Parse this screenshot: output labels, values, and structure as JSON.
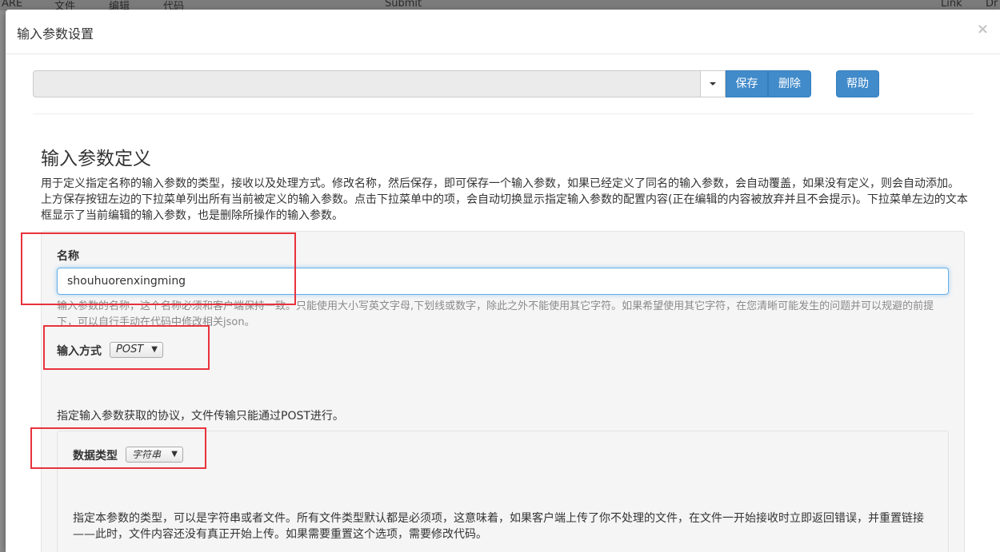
{
  "background": {
    "menu_items": [
      "ARE",
      "文件",
      "编辑",
      "代码",
      "Submit",
      "Link",
      "Dr"
    ]
  },
  "dialog": {
    "title": "输入参数设置",
    "close_label": "×"
  },
  "toolbar": {
    "select_value": "",
    "save_label": "保存",
    "delete_label": "删除",
    "help_label": "帮助"
  },
  "section": {
    "title": "输入参数定义",
    "intro": "用于定义指定名称的输入参数的类型，接收以及处理方式。修改名称，然后保存，即可保存一个输入参数，如果已经定义了同名的输入参数，会自动覆盖，如果没有定义，则会自动添加。上方保存按钮左边的下拉菜单列出所有当前被定义的输入参数。点击下拉菜单中的项，会自动切换显示指定输入参数的配置内容(正在编辑的内容被放弃并且不会提示)。下拉菜单左边的文本框显示了当前编辑的输入参数，也是删除所操作的输入参数。"
  },
  "form": {
    "name_label": "名称",
    "name_value": "shouhuorenxingming",
    "name_help": "输入参数的名称，这个名称必须和客户端保持一致。只能使用大小写英文字母,下划线或数字，除此之外不能使用其它字符。如果希望使用其它字符，在您清晰可能发生的问题并可以规避的前提下，可以自行手动在代码中修改相关json。",
    "method_label": "输入方式",
    "method_value": "POST",
    "method_help": "指定输入参数获取的协议，文件传输只能通过POST进行。",
    "type_label": "数据类型",
    "type_value": "字符串",
    "type_help": "指定本参数的类型，可以是字符串或者文件。所有文件类型默认都是必须项，这意味着，如果客户端上传了你不处理的文件，在文件一开始接收时立即返回错误，并重置链接——此时，文件内容还没有真正开始上传。如果需要重置这个选项，需要修改代码。"
  },
  "colors": {
    "primary": "#428bca",
    "highlight": "#e8323c"
  }
}
